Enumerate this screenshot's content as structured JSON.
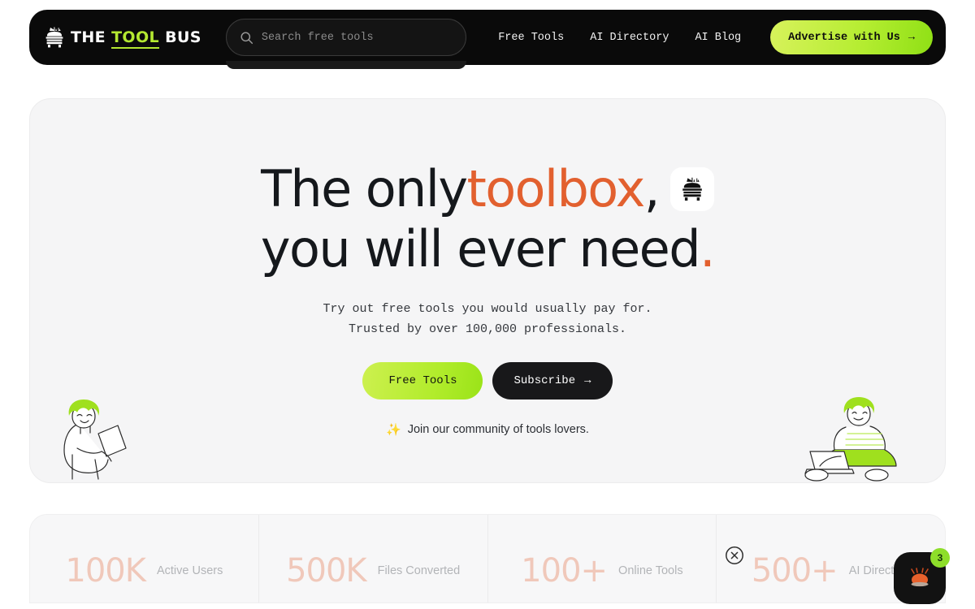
{
  "header": {
    "brand": {
      "the": "THE",
      "tool": "TOOL",
      "bus": "BUS"
    },
    "search": {
      "placeholder": "Search free tools",
      "value": ""
    },
    "nav": [
      {
        "label": "Free Tools"
      },
      {
        "label": "AI Directory"
      },
      {
        "label": "AI Blog"
      }
    ],
    "cta": {
      "label": "Advertise with Us",
      "arrow": "→"
    }
  },
  "hero": {
    "headline_1a": "The only ",
    "headline_1b": "toolbox",
    "headline_1c": ",",
    "headline_2a": "you will ever need",
    "headline_2b": ".",
    "subtitle_line1": "Try out free tools you would usually pay for.",
    "subtitle_line2": "Trusted by over 100,000 professionals.",
    "btn_free": "Free Tools",
    "btn_subscribe": "Subscribe",
    "btn_subscribe_arrow": "→",
    "community_spark": "✨",
    "community_text": "Join our community of tools lovers."
  },
  "stats": [
    {
      "number": "100K",
      "label": "Active Users"
    },
    {
      "number": "500K",
      "label": "Files Converted"
    },
    {
      "number": "100+",
      "label": "Online Tools"
    },
    {
      "number": "500+",
      "label": "AI Directory"
    }
  ],
  "widgets": {
    "chat_badge_count": "3"
  },
  "colors": {
    "accent_green": "#b4e831",
    "accent_orange": "#e2602f",
    "header_bg": "#0a0a0a",
    "hero_bg": "#f5f5f6"
  }
}
